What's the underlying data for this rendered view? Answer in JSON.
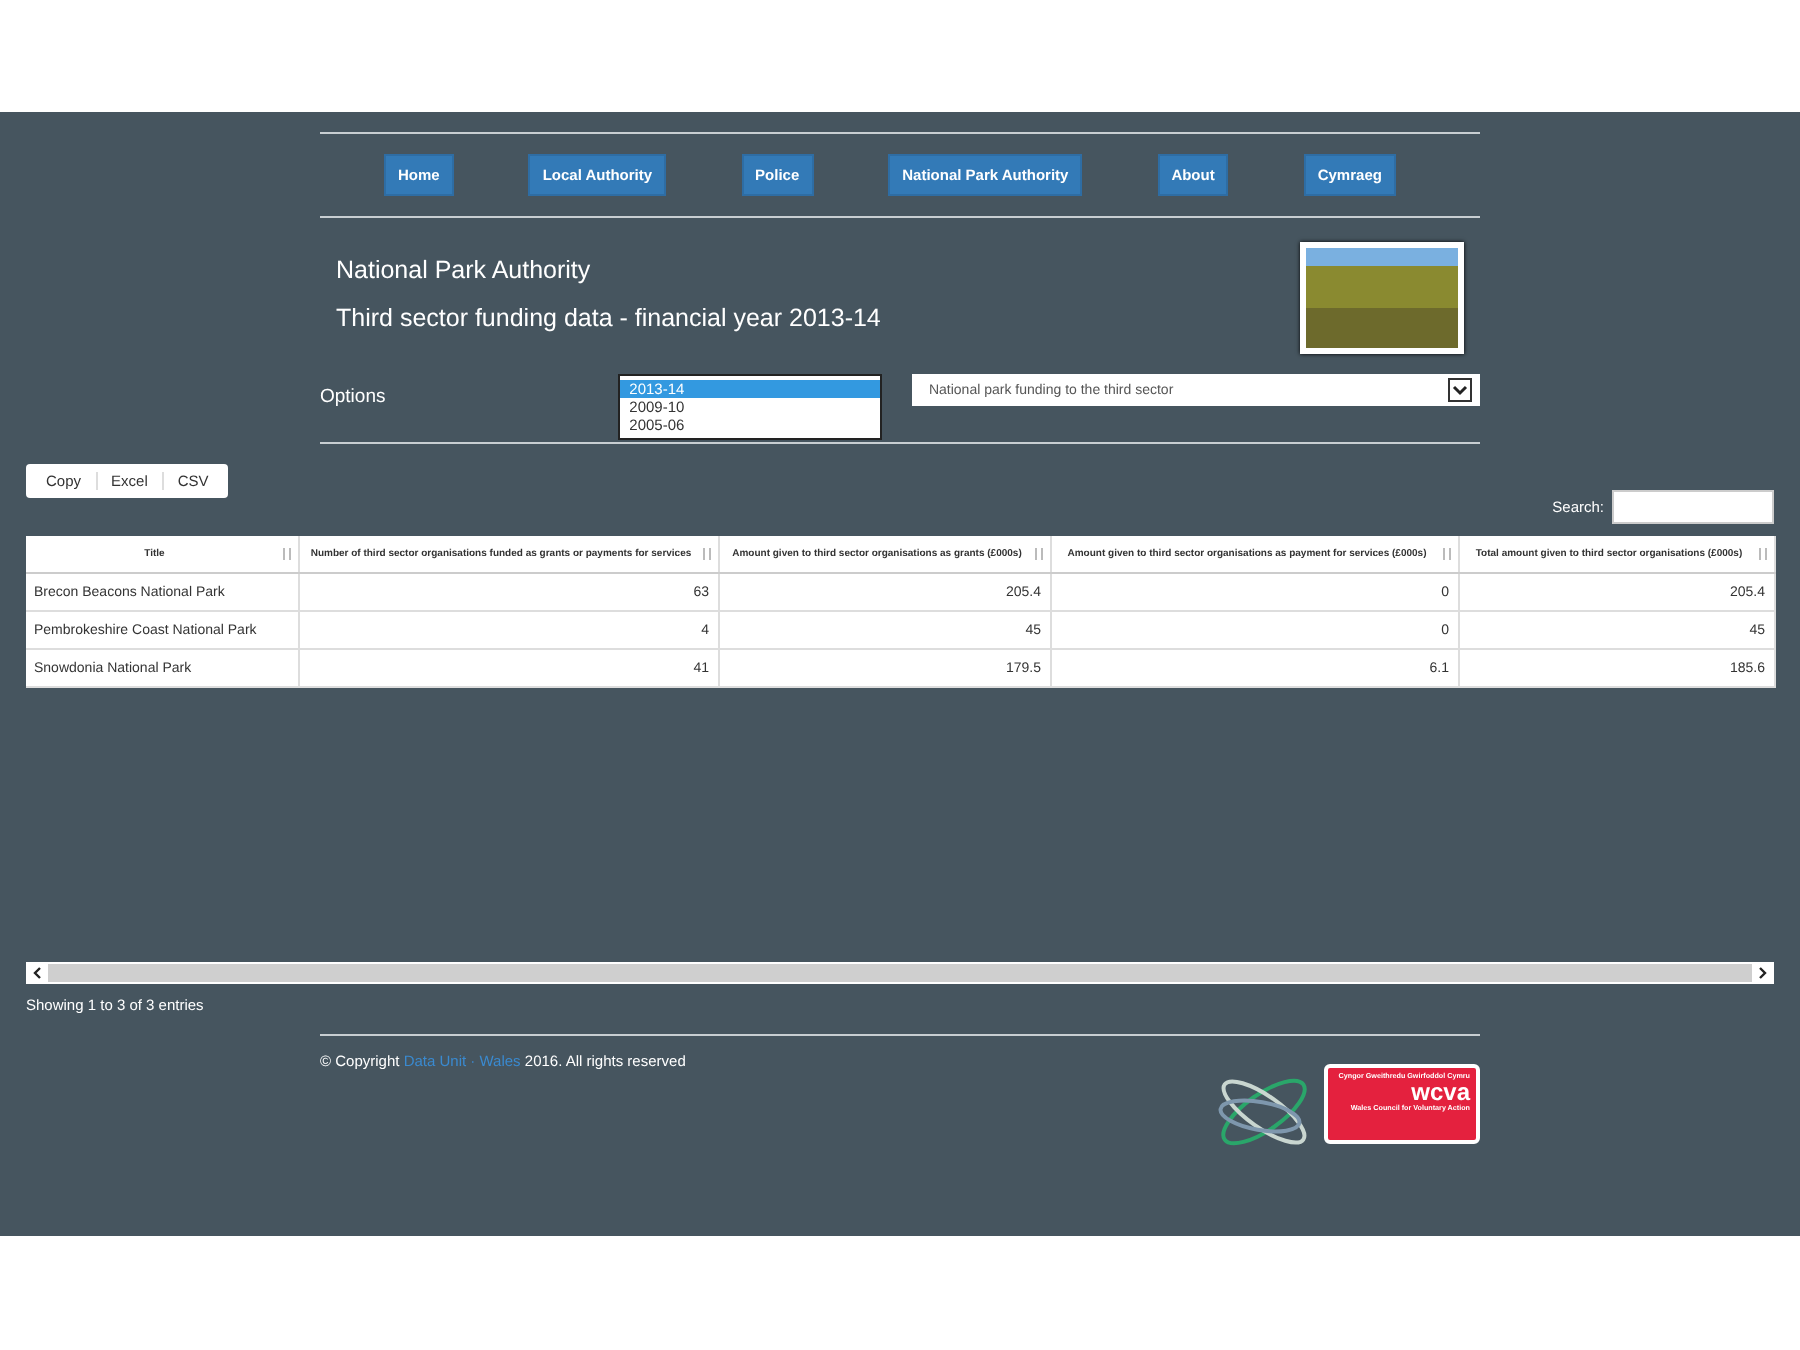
{
  "nav": [
    "Home",
    "Local Authority",
    "Police",
    "National Park Authority",
    "About",
    "Cymraeg"
  ],
  "heading": {
    "title": "National Park Authority",
    "subtitle": "Third sector funding data - financial year 2013-14"
  },
  "options": {
    "label": "Options",
    "years": [
      {
        "label": "2013-14",
        "selected": true
      },
      {
        "label": "2009-10",
        "selected": false
      },
      {
        "label": "2005-06",
        "selected": false
      }
    ],
    "dataset": "National park funding to the third sector"
  },
  "export_buttons": [
    "Copy",
    "Excel",
    "CSV"
  ],
  "search": {
    "label": "Search:"
  },
  "table": {
    "columns": [
      "Title",
      "Number of third sector organisations funded as grants or payments for services",
      "Amount given to third sector organisations as grants (£000s)",
      "Amount given to third sector organisations as payment for services (£000s)",
      "Total amount given to third sector organisations (£000s)"
    ],
    "rows": [
      [
        "Brecon Beacons National Park",
        "63",
        "205.4",
        "0",
        "205.4"
      ],
      [
        "Pembrokeshire Coast National Park",
        "4",
        "45",
        "0",
        "45"
      ],
      [
        "Snowdonia National Park",
        "41",
        "179.5",
        "6.1",
        "185.6"
      ]
    ]
  },
  "info": "Showing 1 to 3 of 3 entries",
  "footer": {
    "prefix": "© Copyright",
    "link": "Data Unit · Wales",
    "suffix": "2016. All rights reserved",
    "logo_lines": [
      "Cyngor Gweithredu Gwirfoddol Cymru",
      "wcva",
      "Wales Council for Voluntary Action"
    ]
  }
}
